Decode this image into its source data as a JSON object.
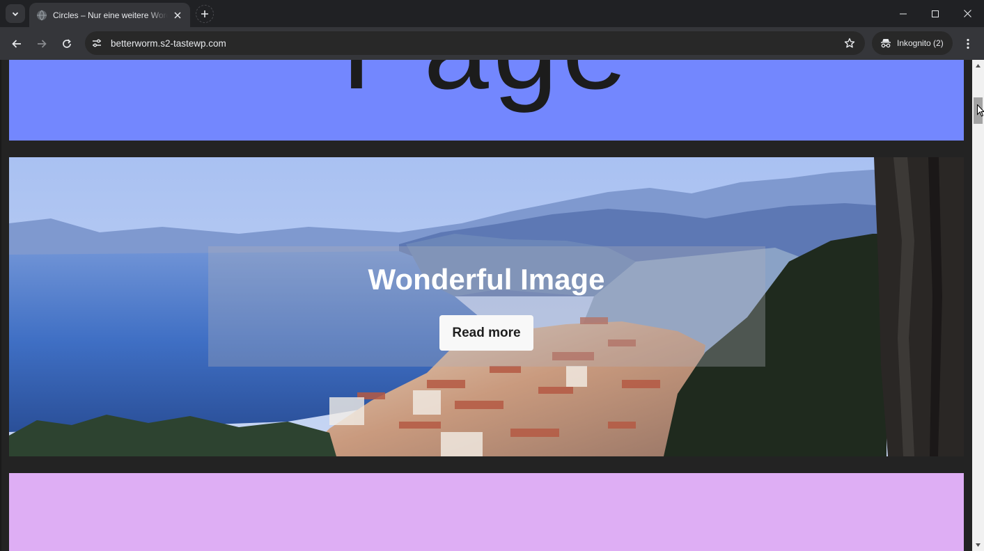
{
  "browser": {
    "tab": {
      "title": "Circles – Nur eine weitere WordPress-Website"
    },
    "address": {
      "url": "betterworm.s2-tastewp.com"
    },
    "incognito": {
      "label": "Inkognito (2)"
    }
  },
  "page": {
    "hero_heading": "Page",
    "cover": {
      "title": "Wonderful Image",
      "button_label": "Read more"
    }
  },
  "colors": {
    "hero_blue": "#7387fe",
    "lavender": "#deaef4",
    "page_bg": "#232323",
    "chrome_dark": "#202124",
    "chrome_toolbar": "#35363a"
  },
  "icons": {
    "tab_search": "chevron-down-icon",
    "favicon": "globe-icon",
    "tab_close": "close-icon",
    "new_tab": "plus-icon",
    "back": "arrow-left-icon",
    "forward": "arrow-right-icon",
    "reload": "reload-icon",
    "site_info": "tune-icon",
    "bookmark": "star-icon",
    "incognito": "incognito-icon",
    "menu": "more-vert-icon"
  }
}
